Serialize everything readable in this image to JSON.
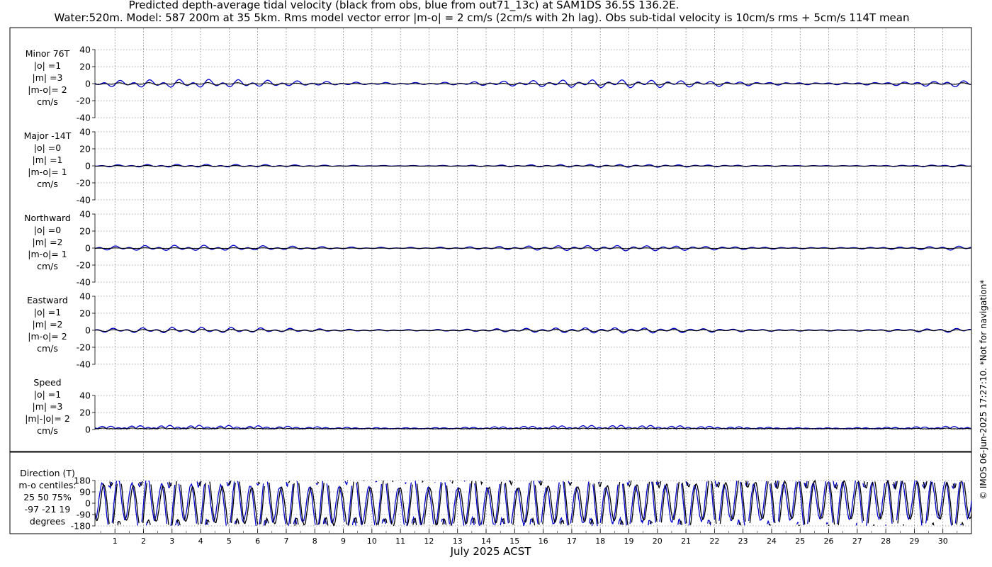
{
  "header": {
    "title_line1": "Predicted depth-average tidal velocity (black from obs, blue from out71_13c) at SAM1DS 36.5S 136.2E.",
    "title_line2": "Water:520m. Model: 587 200m at 35 5km. Rms model vector error |m-o| = 2 cm/s (2cm/s with 2h lag). Obs sub-tidal velocity is 10cm/s rms + 5cm/s 114T mean"
  },
  "footer": {
    "xlabel": "July 2025 ACST",
    "copyright": "© IMOS 06-Jun-2025 17:27:10. *Not for navigation*"
  },
  "chart_data": [
    {
      "type": "line",
      "id": "minor",
      "label_lines": [
        "Minor 76T",
        "|o| =1",
        "|m| =3",
        "|m-o|= 2",
        "cm/s"
      ],
      "ylim": [
        -40,
        40
      ],
      "yticks": [
        "40",
        "20",
        "0",
        "-20",
        "-40"
      ],
      "obs_amp": 1,
      "model_amp": 3
    },
    {
      "type": "line",
      "id": "major",
      "label_lines": [
        "Major -14T",
        "|o| =0",
        "|m| =1",
        "|m-o|= 1",
        "cm/s"
      ],
      "ylim": [
        -40,
        40
      ],
      "yticks": [
        "40",
        "20",
        "0",
        "-20",
        "-40"
      ],
      "obs_amp": 0,
      "model_amp": 1
    },
    {
      "type": "line",
      "id": "north",
      "label_lines": [
        "Northward",
        "|o| =0",
        "|m| =2",
        "|m-o|= 1",
        "cm/s"
      ],
      "ylim": [
        -40,
        40
      ],
      "yticks": [
        "40",
        "20",
        "0",
        "-20",
        "-40"
      ],
      "obs_amp": 0,
      "model_amp": 2
    },
    {
      "type": "line",
      "id": "east",
      "label_lines": [
        "Eastward",
        "|o| =1",
        "|m| =2",
        "|m-o|= 2",
        "cm/s"
      ],
      "ylim": [
        -40,
        40
      ],
      "yticks": [
        "40",
        "20",
        "0",
        "-20",
        "-40"
      ],
      "obs_amp": 1,
      "model_amp": 2
    },
    {
      "type": "line",
      "id": "speed",
      "label_lines": [
        "Speed",
        "|o| =1",
        "|m| =3",
        "|m|-|o|= 2",
        "cm/s"
      ],
      "ylim": [
        0,
        40
      ],
      "yticks": [
        "40",
        "20",
        "0"
      ],
      "obs_amp": 1,
      "model_amp": 3
    },
    {
      "type": "line",
      "id": "direction",
      "label_lines": [
        "Direction (T)",
        "m-o centiles:",
        "25  50  75%",
        "-97 -21  19",
        "degrees"
      ],
      "ylim": [
        -180,
        180
      ],
      "yticks": [
        "180",
        "90",
        "0",
        "-90",
        "-180"
      ]
    }
  ],
  "x_axis": {
    "days": [
      "1",
      "2",
      "3",
      "4",
      "5",
      "6",
      "7",
      "8",
      "9",
      "10",
      "11",
      "12",
      "13",
      "14",
      "15",
      "16",
      "17",
      "18",
      "19",
      "20",
      "21",
      "22",
      "23",
      "24",
      "25",
      "26",
      "27",
      "28",
      "29",
      "30"
    ],
    "xlim_days": [
      0.3,
      31.0
    ]
  },
  "colors": {
    "obs": "#000000",
    "model": "#0000cc",
    "grid": "#555555"
  }
}
